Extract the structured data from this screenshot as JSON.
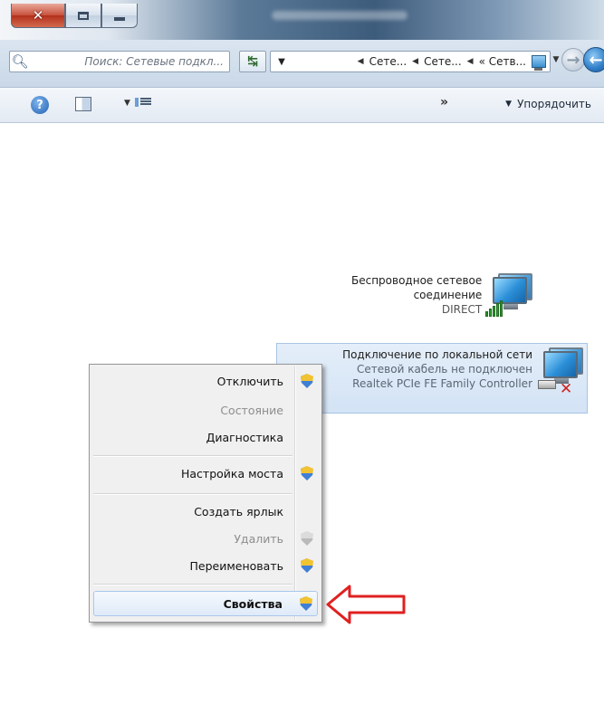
{
  "window": {
    "close_glyph": "✕"
  },
  "address": {
    "search_placeholder": "Поиск: Сетевые подкл...",
    "crumbs": [
      "« Сетв...",
      "Сете...",
      "Сете..."
    ]
  },
  "toolbar": {
    "organize_label": "Упорядочить",
    "more_label": "»",
    "help_glyph": "?"
  },
  "connections": [
    {
      "name": "Беспроводное сетевое",
      "name2": "соединение",
      "status": "DIRECT"
    },
    {
      "name": "Подключение по локальной сети",
      "status": "Сетевой кабель не подключен",
      "device": "Realtek PCIe FE Family Controller"
    }
  ],
  "context_menu": {
    "items": [
      {
        "label": "Отключить",
        "shield": true,
        "disabled": false
      },
      {
        "label": "Состояние",
        "shield": false,
        "disabled": true
      },
      {
        "label": "Диагностика",
        "shield": false,
        "disabled": false
      },
      {
        "label": "Настройка моста",
        "shield": true,
        "disabled": false
      },
      {
        "label": "Создать ярлык",
        "shield": false,
        "disabled": false
      },
      {
        "label": "Удалить",
        "shield": true,
        "disabled": true
      },
      {
        "label": "Переименовать",
        "shield": true,
        "disabled": false
      },
      {
        "label": "Свойства",
        "shield": true,
        "disabled": false,
        "bold": true,
        "highlighted": true
      }
    ]
  },
  "colors": {
    "highlight_border": "#a8c8ec",
    "annotation_arrow": "#e02020"
  }
}
